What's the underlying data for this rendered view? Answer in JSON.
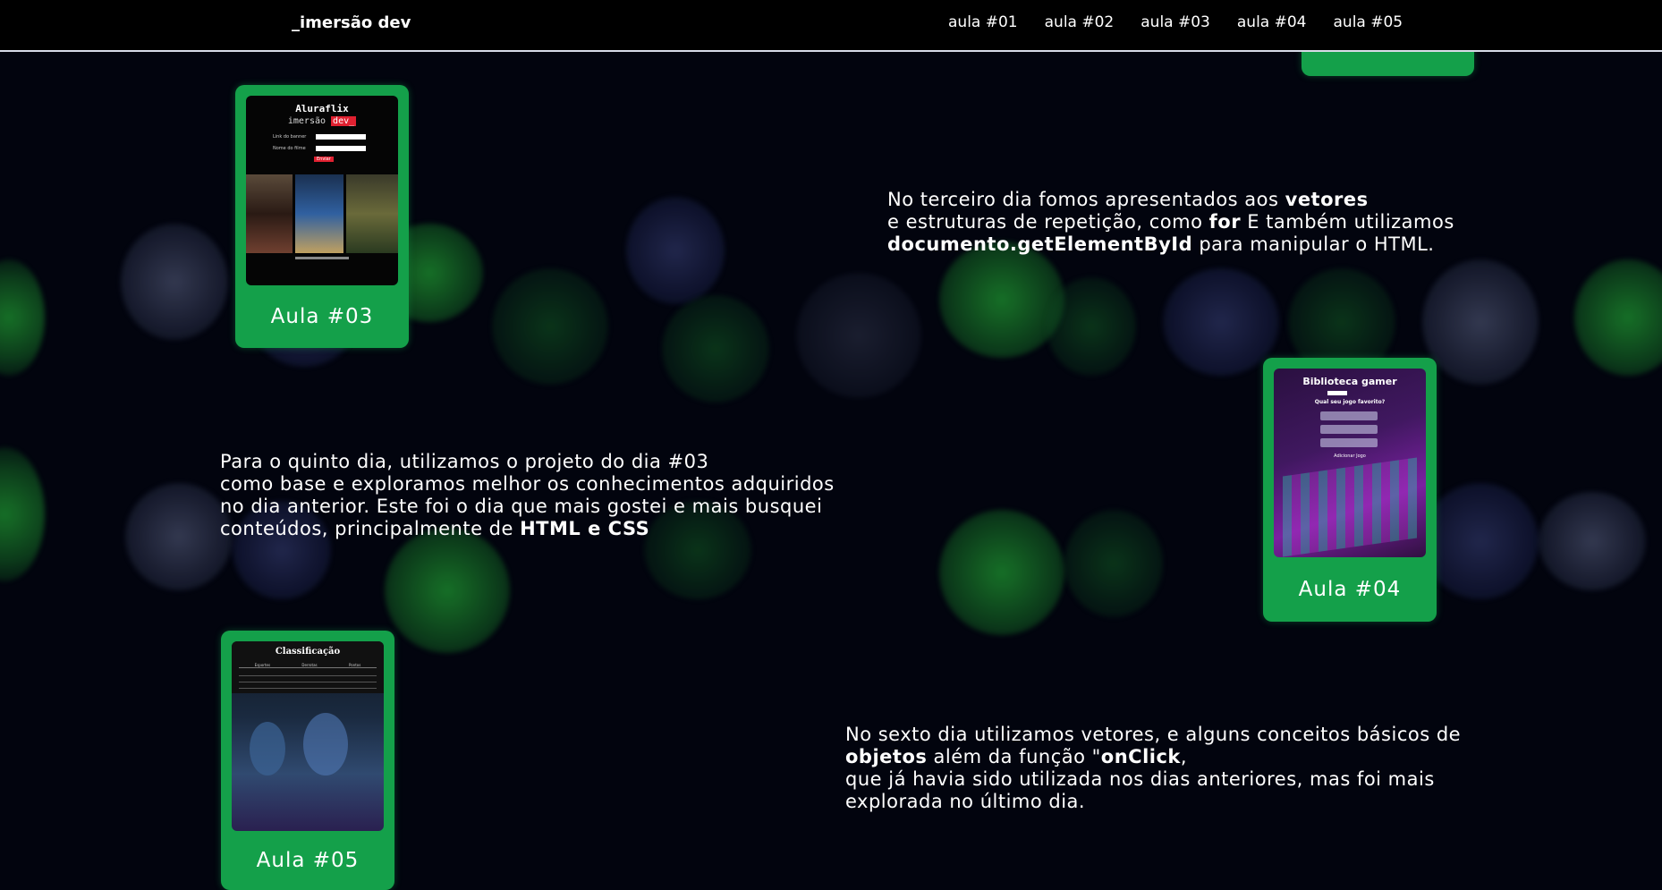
{
  "nav": {
    "brand": "_imersão dev",
    "links": [
      "aula #01",
      "aula #02",
      "aula #03",
      "aula #04",
      "aula #05"
    ]
  },
  "cards": {
    "aula03": {
      "label": "Aula #03",
      "thumb_title": "Aluraflix",
      "thumb_sub": "imersão",
      "thumb_badge": "dev_",
      "field1": "Link do banner",
      "field2": "Nome do filme",
      "button": "Enviar"
    },
    "aula04": {
      "label": "Aula #04",
      "thumb_title": "Biblioteca gamer",
      "thumb_question": "Qual seu jogo favorito?",
      "thumb_button": "Adicionar Jogo"
    },
    "aula05": {
      "label": "Aula #05",
      "thumb_title": "Classificação",
      "thumb_headers": [
        "Esportes",
        "Derrotas",
        "Pontos"
      ]
    }
  },
  "texts": {
    "day3": {
      "l1a": "No terceiro dia fomos apresentados aos ",
      "l1b": "vetores",
      "l2a": "e estruturas de repetição, como ",
      "l2b": "for",
      "l2c": " E também utilizamos",
      "l3a": "documento.getElementById",
      "l3b": " para manipular o HTML."
    },
    "day5": {
      "l1": "Para o quinto dia, utilizamos o projeto do dia #03",
      "l2": "como base e exploramos melhor os conhecimentos adquiridos",
      "l3": "no dia anterior. Este foi o dia que mais gostei e mais busquei",
      "l4a": "conteúdos, principalmente de ",
      "l4b": "HTML e CSS"
    },
    "day6": {
      "l1": "No sexto dia utilizamos vetores, e alguns conceitos básicos de",
      "l2a": "objetos",
      "l2b": " além da função \"",
      "l2c": "onClick",
      "l2d": ",",
      "l3": "que já havia sido utilizada nos dias anteriores, mas foi mais",
      "l4": "explorada no último dia."
    }
  },
  "colors": {
    "background": "#02040e",
    "card": "#14a04a",
    "nav": "#000000",
    "accent_red": "#e02030"
  }
}
